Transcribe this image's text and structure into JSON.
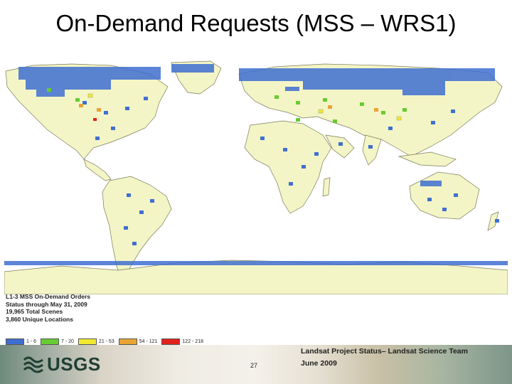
{
  "slide": {
    "title": "On-Demand Requests (MSS – WRS1)",
    "page_number": "27",
    "footer_line1": "Landsat Project Status– Landsat Science Team",
    "footer_line2": "June 2009",
    "logo_text": "USGS"
  },
  "legend": {
    "line1": "L1-3 MSS On-Demand Orders",
    "line2": "Status through May 31, 2009",
    "line3": "19,965 Total Scenes",
    "line4": "3,860 Unique Locations",
    "classes": [
      {
        "label": "1 - 6",
        "color": "#3f6fd1"
      },
      {
        "label": "7 - 20",
        "color": "#66cc33"
      },
      {
        "label": "21 - 53",
        "color": "#f2ea2e"
      },
      {
        "label": "54 - 121",
        "color": "#e9a435"
      },
      {
        "label": "122 - 218",
        "color": "#e3211b"
      }
    ]
  },
  "colors": {
    "land": "#f4f5c6",
    "ocean": "#ffffff",
    "coastline": "#7a7a5a",
    "footer_text": "#222222"
  }
}
